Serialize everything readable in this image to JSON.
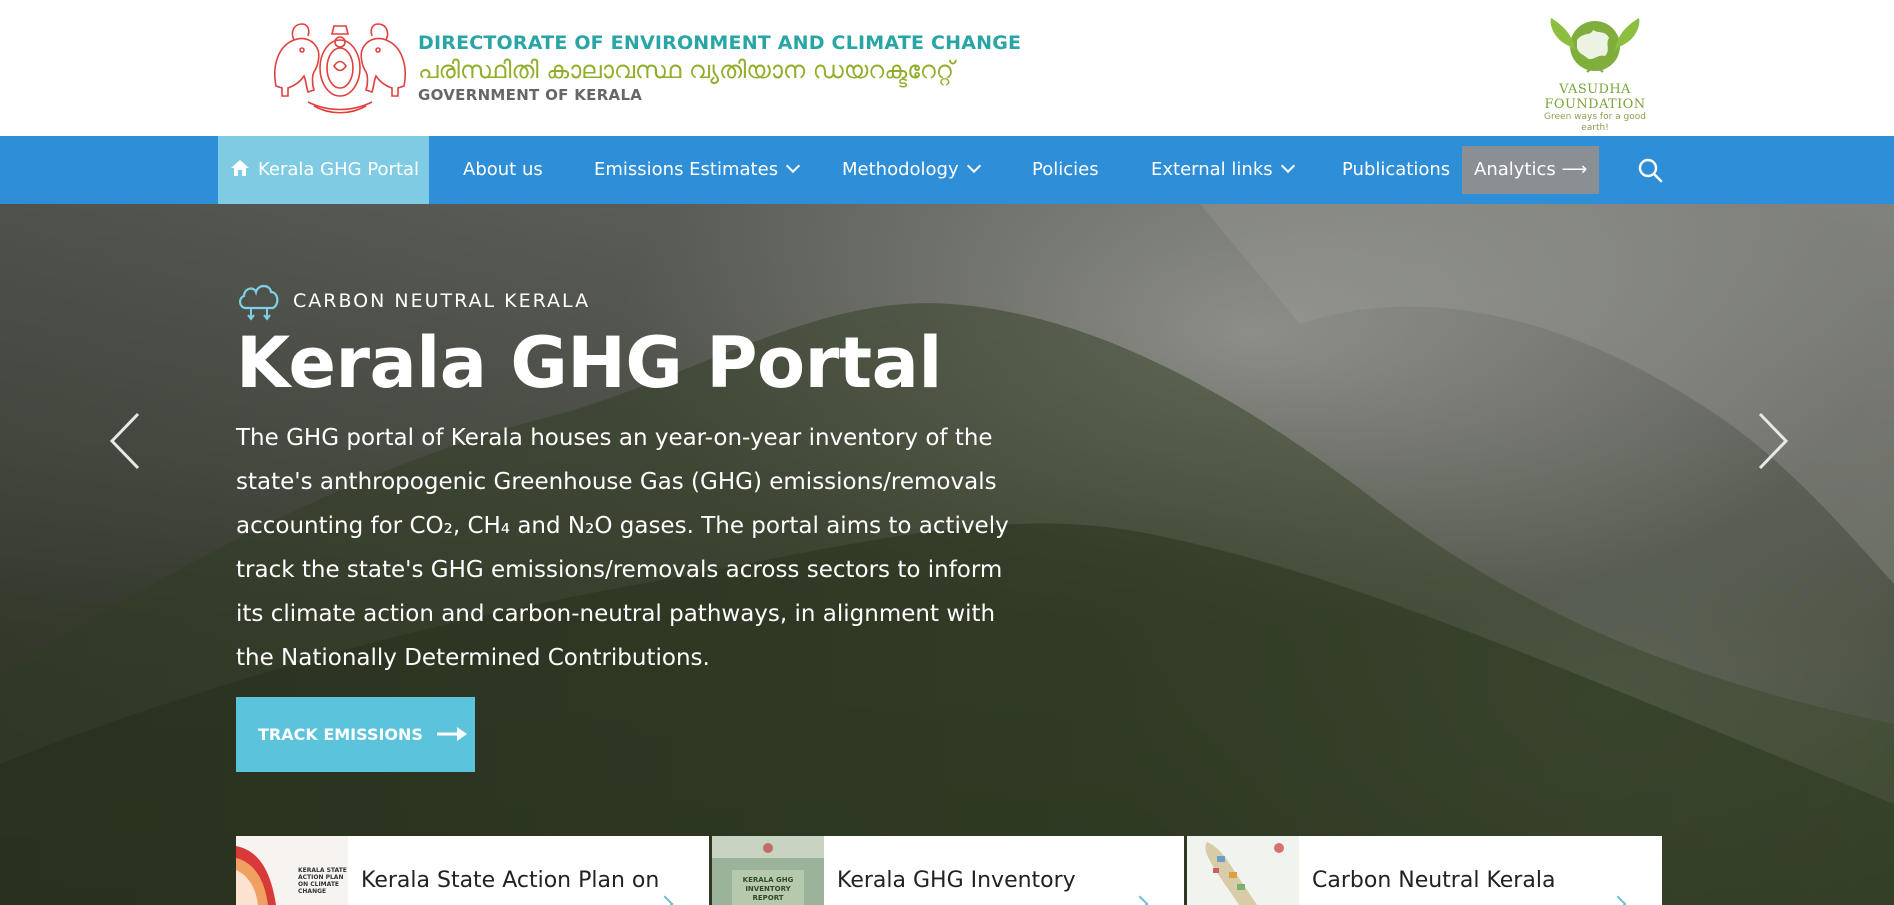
{
  "header": {
    "dept_en": "DIRECTORATE OF ENVIRONMENT AND CLIMATE CHANGE",
    "dept_ml": "പരിസ്ഥിതി കാലാവസ്ഥ വ്യതിയാന ഡയറക്ടറേറ്റ്",
    "dept_gov": "GOVERNMENT OF KERALA",
    "partner_name_line1": "VASUDHA",
    "partner_name_line2": "FOUNDATION",
    "partner_tagline": "Green ways for a good earth!",
    "emblem_color": "#e0403e"
  },
  "nav": {
    "items": [
      {
        "label": "Kerala GHG Portal",
        "active": true
      },
      {
        "label": "About us"
      },
      {
        "label": "Emissions Estimates",
        "dropdown": true
      },
      {
        "label": "Methodology",
        "dropdown": true
      },
      {
        "label": "Policies"
      },
      {
        "label": "External links",
        "dropdown": true
      },
      {
        "label": "Publications"
      }
    ],
    "analytics_label": "Analytics ⟶",
    "colors": {
      "bar": "#2e8fd8",
      "active": "#7ecbe3",
      "analytics": "#8a8f94"
    }
  },
  "hero": {
    "kicker": "CARBON NEUTRAL KERALA",
    "title": "Kerala GHG Portal",
    "description": "The GHG portal of Kerala houses an year-on-year inventory of the state's anthropogenic Greenhouse Gas (GHG) emissions/removals accounting for CO₂, CH₄ and N₂O gases. The portal aims to actively track the state's GHG emissions/removals across sectors to inform its climate action and carbon-neutral pathways, in alignment with the Nationally Determined Contributions.",
    "cta_label": "TRACK EMISSIONS",
    "cta_color": "#5cc3dd"
  },
  "cards": [
    {
      "title": "Kerala State Action Plan on",
      "thumb_text": [
        "KERALA STATE",
        "ACTION PLAN",
        "ON CLIMATE",
        "CHANGE"
      ]
    },
    {
      "title": "Kerala GHG Inventory",
      "thumb_text": [
        "KERALA GHG",
        "INVENTORY",
        "REPORT"
      ]
    },
    {
      "title": "Carbon Neutral Kerala",
      "thumb_text": []
    }
  ],
  "icons": {
    "home": "home-icon",
    "search": "search-icon",
    "cloud": "cloud-icon",
    "prev": "chevron-left-icon",
    "next": "chevron-right-icon"
  }
}
